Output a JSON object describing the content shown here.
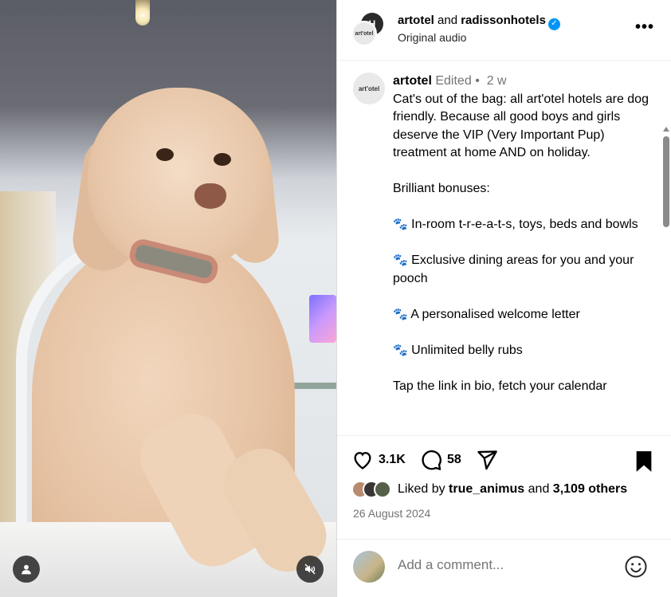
{
  "header": {
    "avatar_back_text": "H",
    "avatar_front_text": "art'otel",
    "user1": "artotel",
    "joiner": "and",
    "user2": "radissonhotels",
    "verified_glyph": "✓",
    "audio": "Original audio",
    "more": "•••"
  },
  "caption": {
    "avatar_text": "art'otel",
    "username": "artotel",
    "edited": "Edited",
    "dot": "•",
    "age": "2 w",
    "intro": "Cat's out of the bag: all art'otel hotels are dog friendly. Because all good boys and girls deserve the VIP (Very Important Pup) treatment at home AND on holiday.",
    "bonuses_heading": "Brilliant bonuses:",
    "paw_glyph": "🐾",
    "bullets": [
      "In-room t-r-e-a-t-s, toys, beds and bowls",
      "Exclusive dining areas for you and your pooch",
      "A personalised welcome letter",
      "Unlimited belly rubs"
    ],
    "outro": "Tap the link in bio, fetch your calendar"
  },
  "actions": {
    "likes_count": "3.1K",
    "comments_count": "58",
    "liked_by_prefix": "Liked by",
    "liked_by_user": "true_animus",
    "liked_by_and": "and",
    "liked_by_others": "3,109 others",
    "date": "26 August 2024"
  },
  "comment": {
    "placeholder": "Add a comment..."
  },
  "colors": {
    "verified": "#0095f6",
    "paw": "#d9601f",
    "meta": "#737373"
  },
  "icons": {
    "like": "heart-icon",
    "comment": "comment-icon",
    "share": "share-icon",
    "save": "bookmark-icon",
    "emoji": "emoji-icon",
    "tag": "user-tag-icon",
    "mute": "speaker-muted-icon"
  }
}
